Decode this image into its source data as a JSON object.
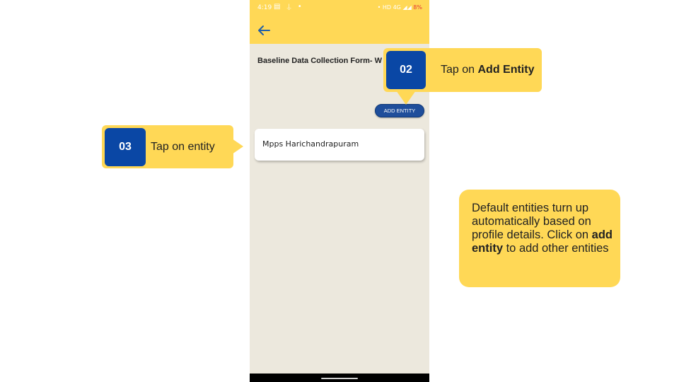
{
  "status_bar": {
    "time": "4:19",
    "indicators": "HD 4G",
    "battery": "8%"
  },
  "app_bar": {
    "back_icon": "arrow-left-icon"
  },
  "form": {
    "title": "Baseline Data Collection Form- W"
  },
  "add_entity_button": "ADD ENTITY",
  "entities": [
    "Mpps Harichandrapuram"
  ],
  "callouts": [
    {
      "number": "02",
      "prefix": "Tap on ",
      "bold": "Add Entity"
    },
    {
      "number": "03",
      "prefix": "Tap on entity",
      "bold": ""
    }
  ],
  "info": {
    "part1": "Default entities turn up automatically based on profile details. Click on ",
    "bold": "add entity",
    "part2": " to add other entities"
  },
  "colors": {
    "callout_yellow": "#ffd856",
    "badge_blue": "#0a47a5",
    "app_background": "#ece8dd",
    "button_blue": "#1f4e9b"
  }
}
